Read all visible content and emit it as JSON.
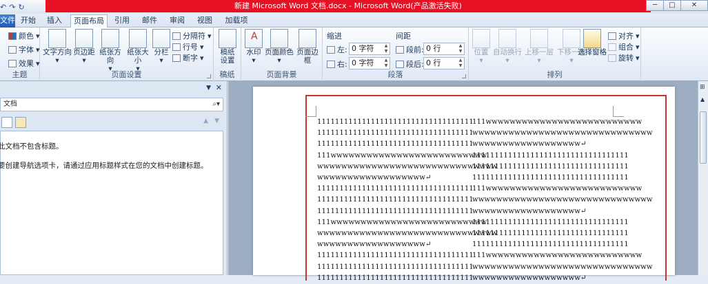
{
  "titlebar": {
    "title": "新建 Microsoft Word 文档.docx - Microsoft Word(产品激活失败)",
    "min": "─",
    "max": "□",
    "close": "✕"
  },
  "qat": {
    "undo": "↶",
    "redo": "↷",
    "refresh": "↻"
  },
  "tabs": [
    "文件",
    "开始",
    "插入",
    "页面布局",
    "引用",
    "邮件",
    "审阅",
    "视图",
    "加载项"
  ],
  "help": "?",
  "ribbon": {
    "theme": {
      "colors": "颜色",
      "fonts": "字体",
      "effects": "效果",
      "label": "主题"
    },
    "page_setup": {
      "text_dir": "文字方向",
      "margins": "页边距",
      "orientation": "纸张方向",
      "size": "纸张大小",
      "columns": "分栏",
      "breaks": "分隔符",
      "line_numbers": "行号",
      "hyphenation": "断字",
      "label": "页面设置"
    },
    "draft": {
      "setup": "稿纸\n设置",
      "label": "稿纸"
    },
    "page_bg": {
      "watermark": "水印",
      "page_color": "页面颜色",
      "page_borders": "页面边框",
      "label": "页面背景"
    },
    "paragraph": {
      "indent": "缩进",
      "spacing": "间距",
      "left": "左:",
      "right": "右:",
      "before": "段前:",
      "after": "段后:",
      "left_val": "0 字符",
      "right_val": "0 字符",
      "before_val": "0 行",
      "after_val": "0 行",
      "label": "段落"
    },
    "arrange": {
      "position": "位置",
      "wrap": "自动换行",
      "forward": "上移一层",
      "backward": "下移一层",
      "selection_pane": "选择窗格",
      "align": "对齐",
      "group": "组合",
      "rotate": "旋转",
      "label": "排列"
    }
  },
  "nav": {
    "search_placeholder": "文档",
    "empty1": "此文档不包含标题。",
    "empty2": "要创建导航选项卡，请通过应用标题样式在您的文档中创建标题。"
  },
  "doc": {
    "col1": [
      "11111111111111111111111111111111111",
      "11111111111111111111111111111111111",
      "11111111111111111111111111111111111",
      "111wwwwwwwwwwwwwwwwwwwwwwwwww",
      "wwwwwwwwwwwwwwwwwwwwwwwwwwwwww",
      "wwwwwwwwwwwwwwwwww↵",
      "11111111111111111111111111111111111",
      "11111111111111111111111111111111111",
      "11111111111111111111111111111111111",
      "111wwwwwwwwwwwwwwwwwwwwwwwwww",
      "wwwwwwwwwwwwwwwwwwwwwwwwwwwwww",
      "wwwwwwwwwwwwwwwwww↵",
      "11111111111111111111111111111111111",
      "11111111111111111111111111111111111",
      "11111111111111111111111111111111111"
    ],
    "col2": [
      "111wwwwwwwwwwwwwwwwwwwwwwwwww",
      "wwwwwwwwwwwwwwwwwwwwwwwwwwwwww",
      "wwwwwwwwwwwwwwwwww↵",
      "11111111111111111111111111111111111",
      "11111111111111111111111111111111111",
      "11111111111111111111111111111111111",
      "111wwwwwwwwwwwwwwwwwwwwwwwwww",
      "wwwwwwwwwwwwwwwwwwwwwwwwwwwwww",
      "wwwwwwwwwwwwwwwwww↵",
      "11111111111111111111111111111111111",
      "11111111111111111111111111111111111",
      "11111111111111111111111111111111111",
      "111wwwwwwwwwwwwwwwwwwwwwwwwww",
      "wwwwwwwwwwwwwwwwwwwwwwwwwwwwww",
      "wwwwwwwwwwwwwwwwww↵"
    ]
  }
}
